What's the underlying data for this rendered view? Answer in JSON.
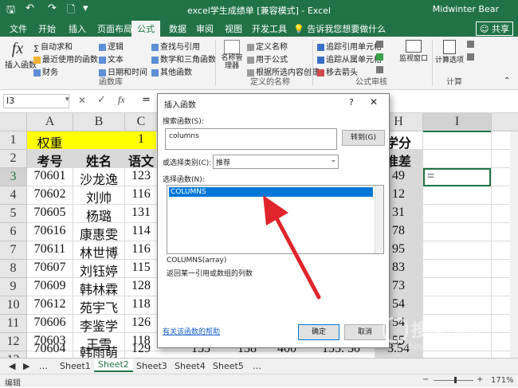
{
  "window": {
    "title": "excel学生成绩单 [兼容模式] - Excel",
    "user": "Midwinter Bear"
  },
  "tabs": [
    "文件",
    "开始",
    "插入",
    "页面布局",
    "公式",
    "数据",
    "审阅",
    "视图",
    "开发工具"
  ],
  "active_tab": "公式",
  "tell_me": "告诉我您想要做什么",
  "share": "共享",
  "ribbon": {
    "insert_function": "插入函数",
    "function_library": {
      "items": [
        "自动求和",
        "最近使用的函数",
        "财务",
        "逻辑",
        "文本",
        "日期和时间",
        "查找与引用",
        "数学和三角函数",
        "其他函数"
      ],
      "group_label": "函数库"
    },
    "defined_names": {
      "name_manager": "名称管理器",
      "items": [
        "定义名称",
        "用于公式",
        "根据所选内容创建"
      ],
      "group_label": "定义的名称"
    },
    "formula_auditing": {
      "items": [
        "追踪引用单元格",
        "追踪从属单元格",
        "移去箭头"
      ],
      "watch_window": "监视窗口",
      "group_label": "公式审核"
    },
    "calculation": {
      "options": "计算选项",
      "group_label": "计算"
    }
  },
  "formula_bar": {
    "name_box": "I3",
    "fx": "fx",
    "value": "="
  },
  "columns": [
    "A",
    "B",
    "C",
    "H",
    "I"
  ],
  "rows": [
    {
      "num": "1",
      "a": "权重",
      "b": "",
      "c": "1",
      "h": "学分"
    },
    {
      "num": "2",
      "a": "考号",
      "b": "姓名",
      "c": "语文",
      "h": "准差"
    },
    {
      "num": "3",
      "a": "70601",
      "b": "沙龙逸",
      "c": "123",
      "h": "49",
      "i": "="
    },
    {
      "num": "4",
      "a": "70602",
      "b": "刘帅",
      "c": "116",
      "h": "12"
    },
    {
      "num": "5",
      "a": "70605",
      "b": "杨璐",
      "c": "131",
      "h": "31"
    },
    {
      "num": "6",
      "a": "70616",
      "b": "康惠雯",
      "c": "114",
      "h": "78"
    },
    {
      "num": "7",
      "a": "70611",
      "b": "林世博",
      "c": "116",
      "h": "95"
    },
    {
      "num": "8",
      "a": "70607",
      "b": "刘钰婷",
      "c": "115",
      "h": "83"
    },
    {
      "num": "9",
      "a": "70609",
      "b": "韩林霖",
      "c": "128",
      "h": "73"
    },
    {
      "num": "10",
      "a": "70612",
      "b": "苑宇飞",
      "c": "118",
      "h": "54"
    },
    {
      "num": "11",
      "a": "70606",
      "b": "李鉴学",
      "c": "126",
      "h": "54"
    },
    {
      "num": "12",
      "a": "70603",
      "b": "王雪",
      "c": "118",
      "h": "55"
    },
    {
      "num": "13",
      "a": "70604",
      "b": "韩雨萌",
      "c": "129",
      "h": "3.54",
      "extra": [
        "133",
        "138",
        "400",
        "135. 50"
      ]
    }
  ],
  "sheets": [
    "Sheet1",
    "Sheet2",
    "Sheet3",
    "Sheet4",
    "Sheet5"
  ],
  "active_sheet": "Sheet2",
  "status": {
    "mode": "编辑",
    "zoom": "171%"
  },
  "dialog": {
    "title": "插入函数",
    "help": "?",
    "search_label": "搜索函数(S):",
    "search_value": "columns",
    "go_button": "转到(G)",
    "category_label": "或选择类别(C):",
    "category_value": "推荐",
    "select_label": "选择函数(N):",
    "functions": [
      "COLUMNS"
    ],
    "signature": "COLUMNS(array)",
    "description": "返回某一引用或数组的列数",
    "help_link": "有关该函数的帮助",
    "ok_button": "确定",
    "cancel_button": "取消"
  },
  "watermark": {
    "text": "搜狗指南",
    "url": "zhinan.sogou.com"
  },
  "colors": {
    "excel_green": "#217346",
    "selection_blue": "#0078d7",
    "highlight_yellow": "#ffff00",
    "arrow_red": "#e0242b"
  }
}
